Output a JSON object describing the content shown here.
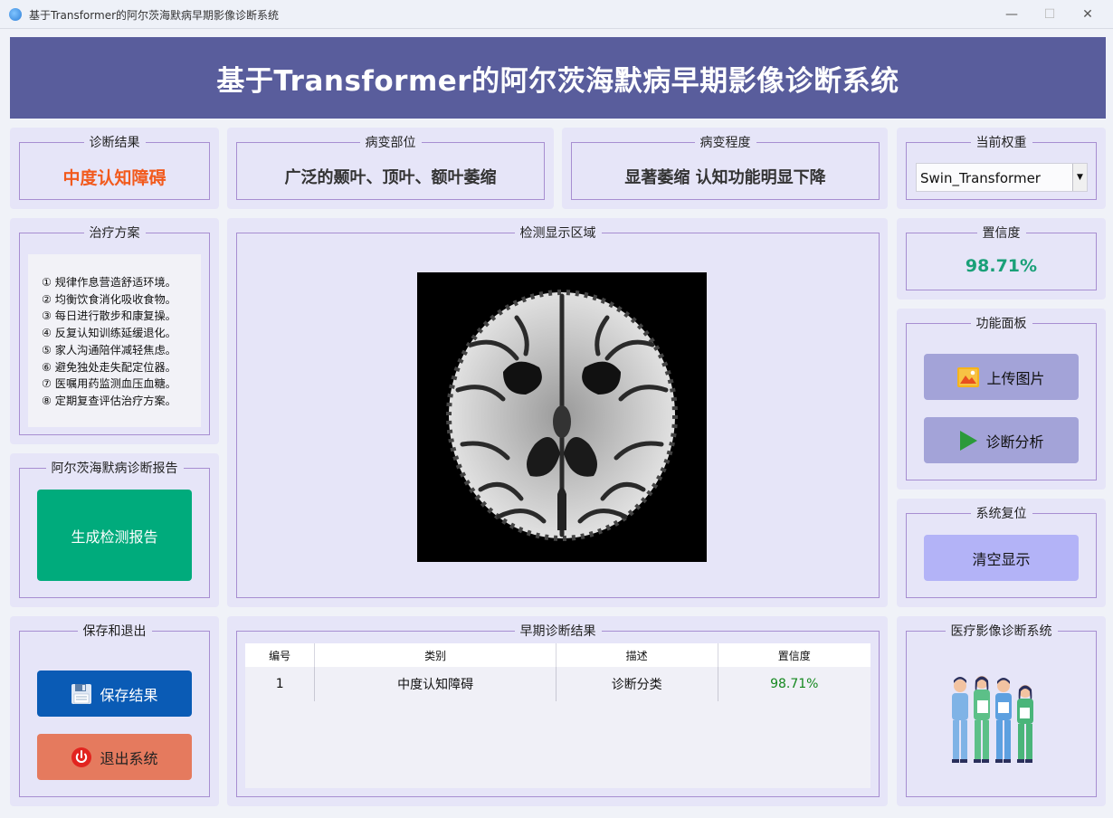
{
  "window": {
    "title": "基于Transformer的阿尔茨海默病早期影像诊断系统",
    "minimize": "—",
    "maximize": "☐",
    "close": "✕"
  },
  "header": {
    "title": "基于Transformer的阿尔茨海默病早期影像诊断系统"
  },
  "diagnosis": {
    "label": "诊断结果",
    "value": "中度认知障碍",
    "color": "#f25a1d"
  },
  "location": {
    "label": "病变部位",
    "value": "广泛的颞叶、顶叶、额叶萎缩"
  },
  "severity": {
    "label": "病变程度",
    "value": "显著萎缩 认知功能明显下降"
  },
  "weights": {
    "label": "当前权重",
    "selected": "Swin_Transformer"
  },
  "treatment": {
    "label": "治疗方案",
    "items": [
      "① 规律作息营造舒适环境。",
      "② 均衡饮食消化吸收食物。",
      "③ 每日进行散步和康复操。",
      "④ 反复认知训练延缓退化。",
      "⑤ 家人沟通陪伴减轻焦虑。",
      "⑥ 避免独处走失配定位器。",
      "⑦ 医嘱用药监测血压血糖。",
      "⑧ 定期复查评估治疗方案。"
    ]
  },
  "display": {
    "label": "检测显示区域"
  },
  "confidence": {
    "label": "置信度",
    "value": "98.71%",
    "color": "#1aa078"
  },
  "functions": {
    "label": "功能面板",
    "upload": "上传图片",
    "analyze": "诊断分析"
  },
  "report": {
    "label": "阿尔茨海默病诊断报告",
    "button": "生成检测报告",
    "color": "#00ab7c"
  },
  "reset": {
    "label": "系统复位",
    "button": "清空显示"
  },
  "save_exit": {
    "label": "保存和退出",
    "save": "保存结果",
    "exit": "退出系统"
  },
  "results": {
    "label": "早期诊断结果",
    "columns": [
      "编号",
      "类别",
      "描述",
      "置信度"
    ],
    "rows": [
      {
        "id": "1",
        "category": "中度认知障碍",
        "desc": "诊断分类",
        "conf": "98.71%"
      }
    ],
    "conf_color": "#14881e"
  },
  "system": {
    "label": "医疗影像诊断系统"
  },
  "colors": {
    "header_bg": "#595d9c",
    "card_bg": "#e6e5f8",
    "group_border": "#a78ed1",
    "save_btn": "#0a5bb5",
    "exit_btn": "#e57a5e",
    "func_btn": "#a3a3d8",
    "reset_btn": "#b3b3f7"
  }
}
